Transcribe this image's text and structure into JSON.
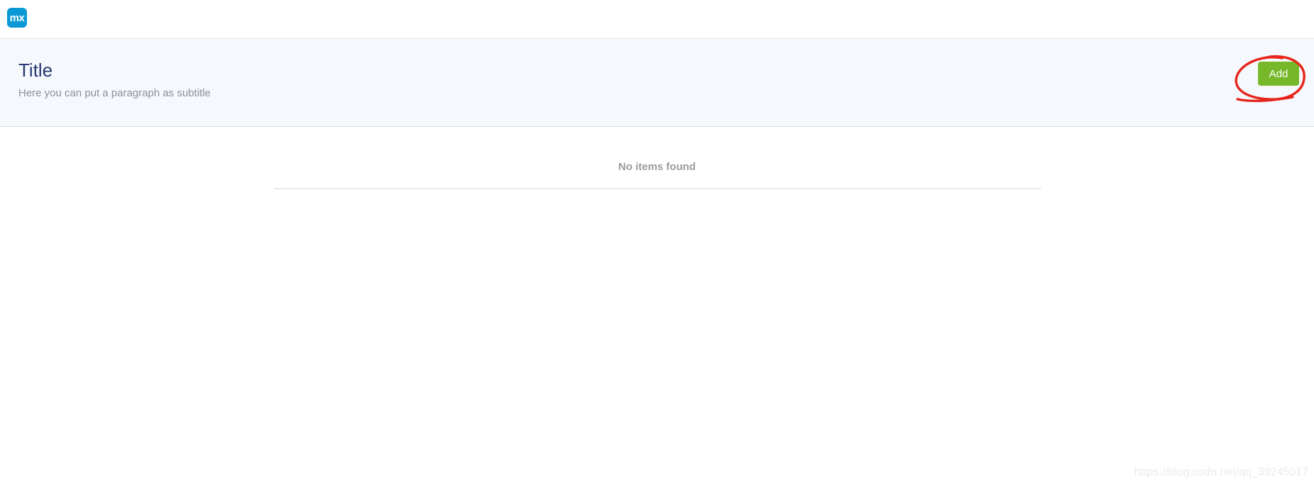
{
  "navbar": {
    "logo_text": "mx",
    "logo_color": "#0a99d6"
  },
  "page_header": {
    "title": "Title",
    "subtitle": "Here you can put a paragraph as subtitle",
    "add_button_label": "Add",
    "background_color": "#f5f8fc",
    "title_color": "#283a73",
    "add_button_color": "#76b82a"
  },
  "content": {
    "empty_message": "No items found"
  },
  "annotation": {
    "description": "hand-drawn red circle around Add button",
    "color": "#e6251c"
  },
  "watermark": {
    "text": "https://blog.csdn.net/qq_39245017"
  }
}
